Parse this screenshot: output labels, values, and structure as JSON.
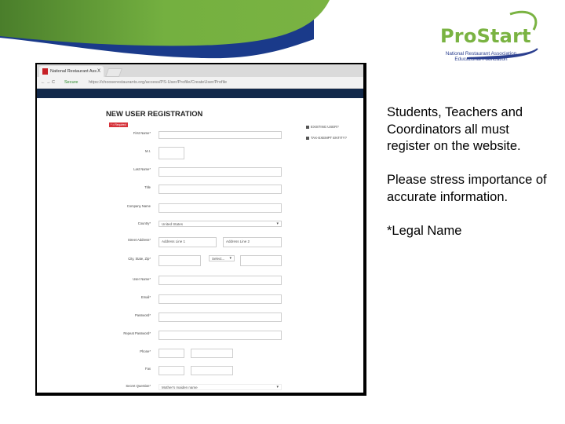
{
  "slide": {
    "logo": {
      "title": "ProStart",
      "subtitle_line1": "National Restaurant Association",
      "subtitle_line2": "Educational Foundation",
      "tm": "™"
    },
    "colors": {
      "banner_green": "#7ab342",
      "banner_green_dark": "#4a7e2b",
      "banner_blue": "#1a3a8a",
      "site_navy": "#12294b",
      "required_red": "#d6323a"
    },
    "notes": {
      "paragraph1": "Students, Teachers and Coordinators all must register on the website.",
      "paragraph2": "Please stress importance of accurate information.",
      "paragraph3": "*Legal Name"
    }
  },
  "browser": {
    "tab_title": "National Restaurant Ass",
    "tab_close": "X",
    "nav_icons": "← → C",
    "secure_label": "Secure",
    "url": "https://chooserestaurants.org/access/PS-User/Profile/CreateUser/Profile"
  },
  "form": {
    "title": "NEW USER REGISTRATION",
    "required_badge": "* = Required",
    "side_options": [
      {
        "label": "EXISTING USER?"
      },
      {
        "label": "TAX-EXEMPT ENTITY?"
      }
    ],
    "fields": {
      "first_name": {
        "label": "First Name*",
        "value": ""
      },
      "mi": {
        "label": "M.I.",
        "value": ""
      },
      "last_name": {
        "label": "Last Name*",
        "value": ""
      },
      "title": {
        "label": "Title",
        "value": ""
      },
      "company_name": {
        "label": "Company Name",
        "value": ""
      },
      "country": {
        "label": "Country*",
        "value": "United States"
      },
      "street_address": {
        "label": "Street Address*",
        "placeholder1": "Address Line 1",
        "placeholder2": "Address Line 2"
      },
      "city_state_zip": {
        "label": "City, State, Zip*",
        "state_value": "Select..."
      },
      "user_name": {
        "label": "User Name*",
        "value": ""
      },
      "email": {
        "label": "Email*",
        "value": ""
      },
      "password": {
        "label": "Password*",
        "value": ""
      },
      "repeat_password": {
        "label": "Repeat Password*",
        "value": ""
      },
      "phone": {
        "label": "Phone*",
        "value": ""
      },
      "fax": {
        "label": "Fax",
        "value": ""
      },
      "security_question": {
        "label": "Secret Question*",
        "value": "Mother's maiden name"
      }
    }
  }
}
